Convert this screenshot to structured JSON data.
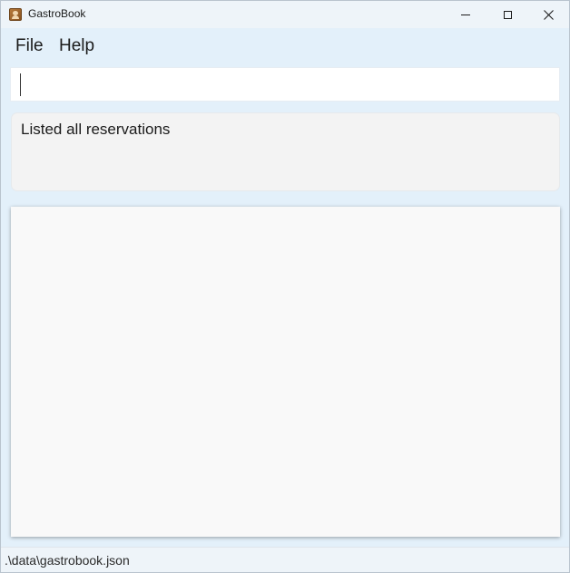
{
  "window": {
    "title": "GastroBook"
  },
  "icons": {
    "app": "address-book-icon",
    "minimize": "minimize-icon",
    "maximize": "maximize-icon",
    "close": "close-icon"
  },
  "menu": {
    "items": [
      {
        "label": "File"
      },
      {
        "label": "Help"
      }
    ]
  },
  "command": {
    "value": ""
  },
  "result": {
    "message": "Listed all reservations"
  },
  "reservations": [],
  "status": {
    "file_path": ".\\data\\gastrobook.json"
  },
  "colors": {
    "window_background": "#e3f0fa",
    "titlebar_background": "#eef4f9",
    "list_background": "#f9f9f9",
    "result_background": "#f3f3f3"
  }
}
